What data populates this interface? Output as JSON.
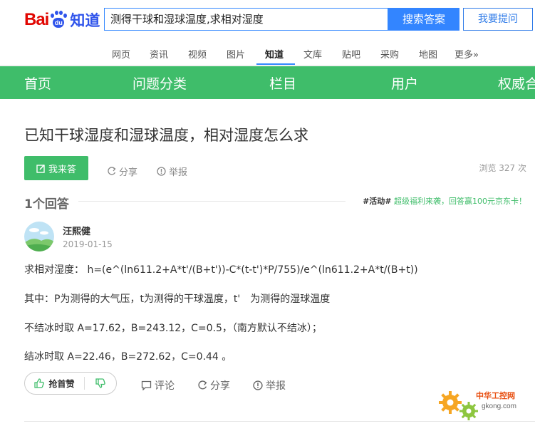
{
  "logo": {
    "bai": "Bai",
    "du": "du",
    "zhidao": "知道"
  },
  "search": {
    "value": "测得干球和湿球温度,求相对湿度",
    "button": "搜索答案",
    "ask": "我要提问"
  },
  "nav": [
    "网页",
    "资讯",
    "视频",
    "图片",
    "知道",
    "文库",
    "贴吧",
    "采购",
    "地图",
    "更多»"
  ],
  "nav_active": "知道",
  "green_nav": [
    "首页",
    "问题分类",
    "栏目",
    "用户",
    "权威合"
  ],
  "question": {
    "title": "已知干球湿度和湿球温度，相对湿度怎么求",
    "answer_button": "我来答",
    "share": "分享",
    "report": "举报",
    "views": "浏览 327 次"
  },
  "answers_header": {
    "count": "1个回答",
    "promo_tag": "#活动#",
    "promo_text": " 超级福利来袭，回答赢100元京东卡！"
  },
  "answer": {
    "user": "汪熙健",
    "date": "2019-01-15",
    "lines": [
      "求相对湿度： h=(e^(ln611.2+A*t'/(B+t'))-C*(t-t')*P/755)/e^(ln611.2+A*t/(B+t))",
      "其中：P为测得的大气压，t为测得的干球温度，t'　为测得的湿球温度",
      "不结冰时取 A=17.62，B=243.12，C=0.5，（南方默认不结冰）；",
      "结冰时取 A=22.46，B=272.62，C=0.44 。"
    ],
    "like": "抢首赞",
    "comment": "评论",
    "share": "分享",
    "report": "举报"
  },
  "watermark": {
    "title": "中华工控网",
    "url": "gkong.com"
  },
  "colors": {
    "green": "#3fbd6a",
    "blue": "#3385ff",
    "red": "#e10601"
  }
}
